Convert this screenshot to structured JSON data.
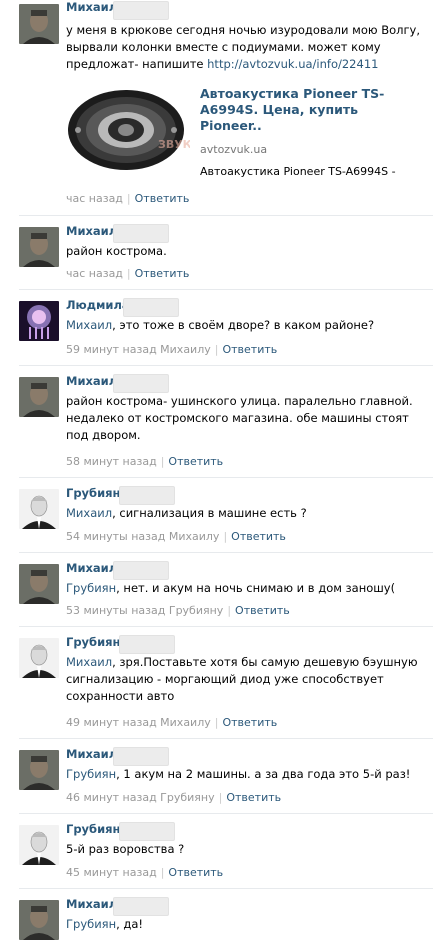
{
  "comments": [
    {
      "name": "Михаил",
      "text_plain": "у меня в крюкове сегодня ночью изуродовали мою Волгу, вырвали колонки вместе с подиумами. может кому предложат- напишите ",
      "link": "http://avtozvuk.ua/info/22411",
      "time": "час назад",
      "reply": "Ответить"
    },
    {
      "name": "Михаил",
      "text": "район кострома.",
      "time": "час назад",
      "reply": "Ответить"
    },
    {
      "name": "Людмила",
      "mention": "Михаил",
      "text": ", это тоже в своём дворе? в каком районе?",
      "time": "59 минут назад Михаилу",
      "reply": "Ответить"
    },
    {
      "name": "Михаил",
      "text": "район кострома- ушинского улица. паралельно главной. недалеко от костромского магазина. обе машины стоят под двором.",
      "time": "58 минут назад",
      "reply": "Ответить"
    },
    {
      "name": "Грубиян",
      "mention": "Михаил",
      "text": ", сигнализация в машине есть ?",
      "time": "54 минуты назад Михаилу",
      "reply": "Ответить"
    },
    {
      "name": "Михаил",
      "mention": "Грубиян",
      "text": ", нет. и акум на ночь снимаю и в дом заношу(",
      "time": "53 минуты назад Грубияну",
      "reply": "Ответить"
    },
    {
      "name": "Грубиян",
      "mention": "Михаил",
      "text": ", зря.Поставьте хотя бы самую дешевую бэушную сигнализацию - моргающий диод уже способствует сохранности авто",
      "time": "49 минут назад Михаилу",
      "reply": "Ответить"
    },
    {
      "name": "Михаил",
      "mention": "Грубиян",
      "text": ", 1 акум на 2 машины. а за два года это 5-й раз!",
      "time": "46 минут назад Грубияну",
      "reply": "Ответить"
    },
    {
      "name": "Грубиян",
      "text": "5-й раз воровства ?",
      "time": "45 минут назад",
      "reply": "Ответить"
    },
    {
      "name": "Михаил",
      "mention": "Грубиян",
      "text": ", да!"
    }
  ],
  "snippet": {
    "title": "Автоакустика Pioneer TS-A6994S. Цена, купить Pioneer..",
    "domain": "avtozvuk.ua",
    "desc": "Автоакустика Pioneer TS-A6994S -"
  }
}
